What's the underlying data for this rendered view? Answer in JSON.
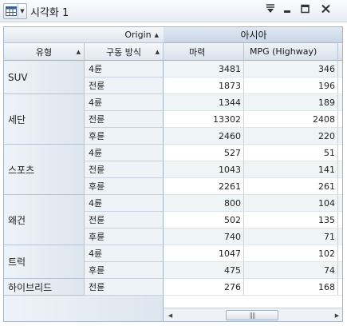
{
  "window": {
    "title": "시각화 1",
    "view_icon": "table-grid-icon",
    "controls": [
      "filter-icon",
      "minimize-icon",
      "maximize-icon",
      "close-icon"
    ]
  },
  "table": {
    "column_group_label": "Origin",
    "column_group_value": "아시아",
    "row_headers": [
      "유형",
      "구동 방식"
    ],
    "measure_headers": [
      "마력",
      "MPG (Highway)"
    ],
    "groups": [
      {
        "type": "SUV",
        "rows": [
          {
            "drive": "4륜",
            "hp": "3481",
            "mpg": "346"
          },
          {
            "drive": "전륜",
            "hp": "1873",
            "mpg": "196"
          }
        ]
      },
      {
        "type": "세단",
        "rows": [
          {
            "drive": "4륜",
            "hp": "1344",
            "mpg": "189"
          },
          {
            "drive": "전륜",
            "hp": "13302",
            "mpg": "2408"
          },
          {
            "drive": "후륜",
            "hp": "2460",
            "mpg": "220"
          }
        ]
      },
      {
        "type": "스포츠",
        "rows": [
          {
            "drive": "4륜",
            "hp": "527",
            "mpg": "51"
          },
          {
            "drive": "전륜",
            "hp": "1043",
            "mpg": "141"
          },
          {
            "drive": "후륜",
            "hp": "2261",
            "mpg": "261"
          }
        ]
      },
      {
        "type": "왜건",
        "rows": [
          {
            "drive": "4륜",
            "hp": "800",
            "mpg": "104"
          },
          {
            "drive": "전륜",
            "hp": "502",
            "mpg": "135"
          },
          {
            "drive": "후륜",
            "hp": "740",
            "mpg": "71"
          }
        ]
      },
      {
        "type": "트럭",
        "rows": [
          {
            "drive": "4륜",
            "hp": "1047",
            "mpg": "102"
          },
          {
            "drive": "후륜",
            "hp": "475",
            "mpg": "74"
          }
        ]
      },
      {
        "type": "하이브리드",
        "rows": [
          {
            "drive": "전륜",
            "hp": "276",
            "mpg": "168"
          }
        ]
      }
    ]
  },
  "scrollbar": {
    "grip": "||||"
  }
}
